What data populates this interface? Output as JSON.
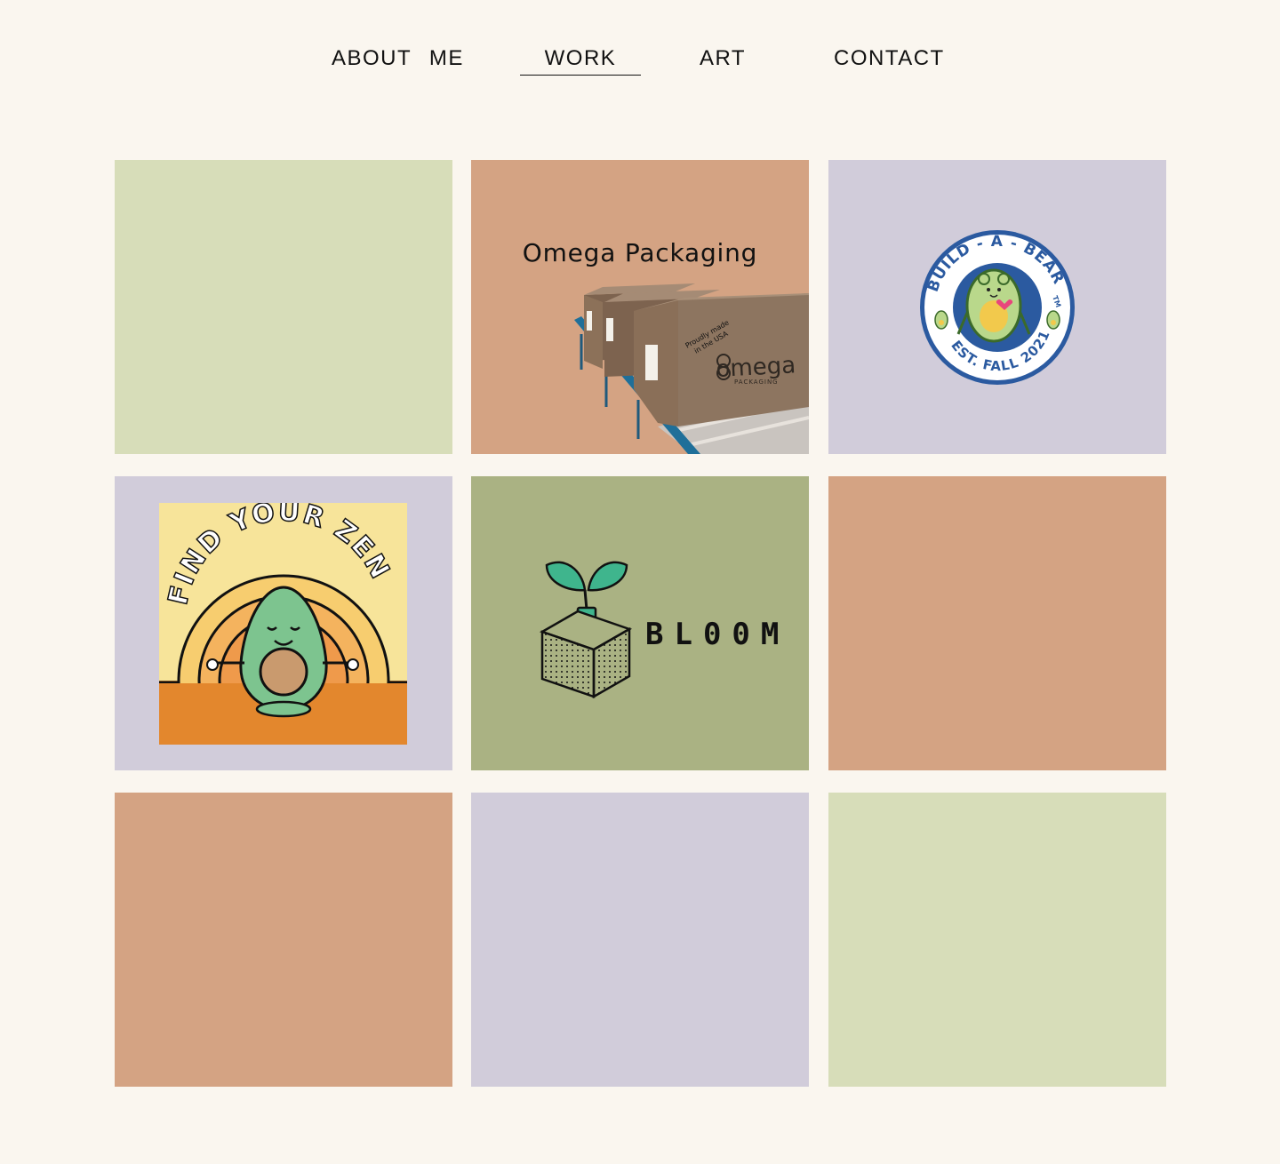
{
  "colors": {
    "background": "#faf6ef",
    "sage": "#d7ddb9",
    "terracotta": "#d4a383",
    "lavender": "#d1ccda",
    "olive": "#aab283"
  },
  "nav": {
    "items": [
      {
        "label": "ABOUT ME",
        "active": false
      },
      {
        "label": "WORK",
        "active": true
      },
      {
        "label": "ART",
        "active": false
      },
      {
        "label": "CONTACT",
        "active": false
      }
    ]
  },
  "tiles": {
    "omega": {
      "title": "Omega Packaging",
      "box_brand": "omega",
      "box_sub": "PACKAGING",
      "box_stamp_1": "Proudly made",
      "box_stamp_2": "in the USA"
    },
    "build_a_bear": {
      "ring_top": "BUILD - A - BEAR",
      "ring_tm": "TM",
      "ring_bottom": "EST. FALL 2021"
    },
    "zen": {
      "headline": "FIND YOUR ZEN"
    },
    "bloom": {
      "word": "BL00M"
    }
  }
}
